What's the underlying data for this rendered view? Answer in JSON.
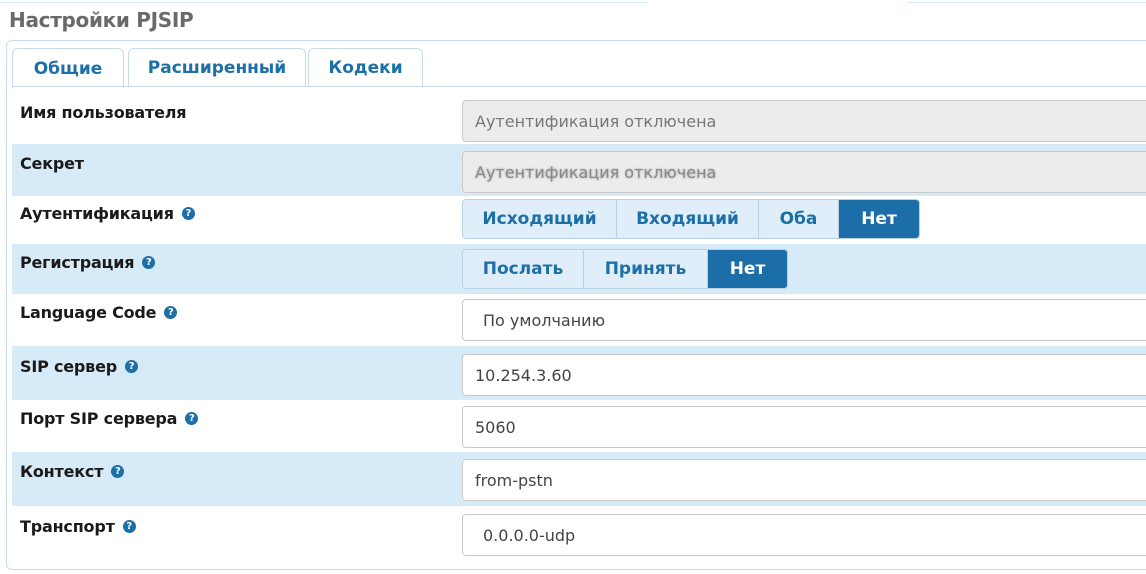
{
  "page": {
    "title": "Настройки PJSIP"
  },
  "tabs": [
    {
      "label": "Общие",
      "active": true
    },
    {
      "label": "Расширенный",
      "active": false
    },
    {
      "label": "Кодеки",
      "active": false
    }
  ],
  "fields": {
    "username": {
      "label": "Имя пользователя",
      "value": "Аутентификация отключена"
    },
    "secret": {
      "label": "Секрет",
      "value": "Аутентификация отключена"
    },
    "authentication": {
      "label": "Аутентификация",
      "options": [
        "Исходящий",
        "Входящий",
        "Оба",
        "Нет"
      ],
      "selected": "Нет"
    },
    "registration": {
      "label": "Регистрация",
      "options": [
        "Послать",
        "Принять",
        "Нет"
      ],
      "selected": "Нет"
    },
    "language_code": {
      "label": "Language Code",
      "value": "По умолчанию"
    },
    "sip_server": {
      "label": "SIP сервер",
      "value": "10.254.3.60"
    },
    "sip_port": {
      "label": "Порт SIP сервера",
      "value": "5060"
    },
    "context": {
      "label": "Контекст",
      "value": "from-pstn"
    },
    "transport": {
      "label": "Транспорт",
      "value": "0.0.0.0-udp"
    }
  },
  "colors": {
    "accent": "#1b6ea8",
    "row_shade": "#d7eaf7",
    "button_bg": "#dfeef8"
  },
  "icons": {
    "help": "question-circle-icon",
    "help_glyph": "?"
  }
}
